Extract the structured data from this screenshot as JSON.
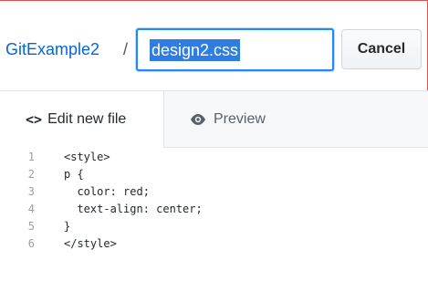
{
  "header": {
    "repo_name": "GitExample2",
    "separator": "/",
    "filename_value": "design2.css",
    "cancel_label": "Cancel"
  },
  "tabs": {
    "edit_label": "Edit new file",
    "edit_icon": "<>",
    "preview_label": "Preview"
  },
  "editor": {
    "lines": [
      {
        "num": "1",
        "text": "<style>"
      },
      {
        "num": "2",
        "text": "p {"
      },
      {
        "num": "3",
        "text": "  color: red;"
      },
      {
        "num": "4",
        "text": "  text-align: center;"
      },
      {
        "num": "5",
        "text": "}"
      },
      {
        "num": "6",
        "text": "</style>"
      }
    ]
  },
  "colors": {
    "accent": "#0366d6",
    "selection": "#2f7de1",
    "frame_border": "#d9534f"
  }
}
